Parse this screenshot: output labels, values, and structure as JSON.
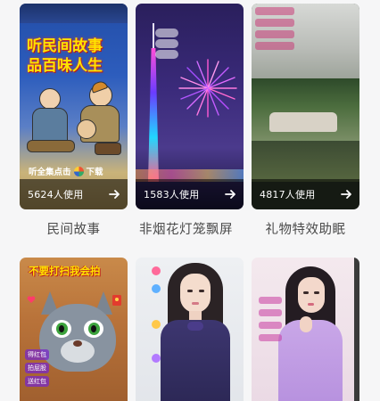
{
  "cards": [
    {
      "title": "民间故事",
      "usage": "5624人使用",
      "headline": [
        "听民间故事",
        "品百味人生"
      ],
      "caption": "听全集点击",
      "caption_suffix": "下载"
    },
    {
      "title": "非烟花灯笼飘屏",
      "usage": "1583人使用"
    },
    {
      "title": "礼物特效助眠",
      "usage": "4817人使用"
    },
    {
      "title": "",
      "headline": [
        "不要打扫我会拍"
      ],
      "chips": [
        "得红包",
        "拍屁股",
        "送红包"
      ]
    },
    {
      "title": ""
    },
    {
      "title": ""
    }
  ],
  "colors": {
    "headline_yellow": "#ffe300",
    "accent_red": "#e8412c",
    "text_gray": "#4a4a4a",
    "background": "#f6f6f7"
  },
  "icons": {
    "arrow": "arrow-right-icon"
  }
}
